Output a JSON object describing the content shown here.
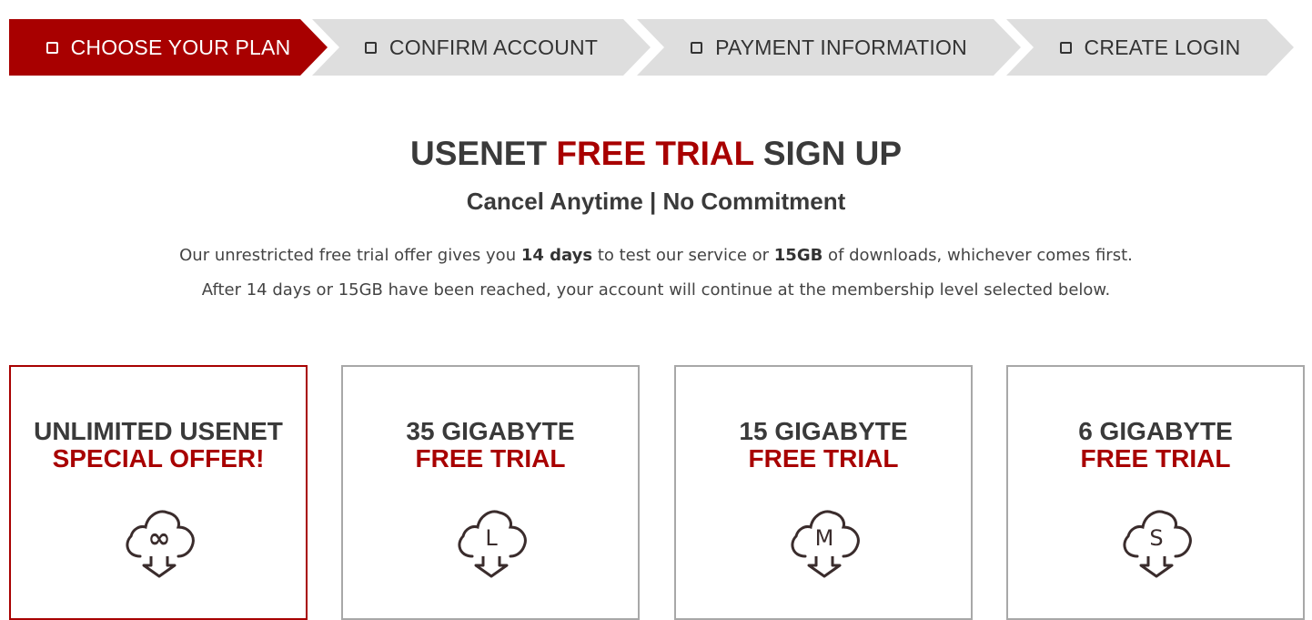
{
  "steps": [
    {
      "label": "CHOOSE YOUR PLAN",
      "active": true
    },
    {
      "label": "CONFIRM ACCOUNT",
      "active": false
    },
    {
      "label": "PAYMENT INFORMATION",
      "active": false
    },
    {
      "label": "CREATE LOGIN",
      "active": false
    }
  ],
  "header": {
    "title_part1": "USENET ",
    "title_highlight": "FREE TRIAL",
    "title_part2": " SIGN UP",
    "subtitle": "Cancel Anytime | No Commitment"
  },
  "description": {
    "line1_a": "Our unrestricted free trial offer gives you ",
    "line1_b": "14 days",
    "line1_c": " to test our service or ",
    "line1_d": "15GB",
    "line1_e": " of downloads, whichever comes first.",
    "line2": "After 14 days or 15GB have been reached, your account will continue at the membership level selected below."
  },
  "plans": [
    {
      "title": "UNLIMITED USENET",
      "subtitle": "SPECIAL OFFER!",
      "icon_label": "∞",
      "icon": "cloud-download-unlimited-icon",
      "selected": true
    },
    {
      "title": "35 GIGABYTE",
      "subtitle": "FREE TRIAL",
      "icon_label": "L",
      "icon": "cloud-download-l-icon",
      "selected": false
    },
    {
      "title": "15 GIGABYTE",
      "subtitle": "FREE TRIAL",
      "icon_label": "M",
      "icon": "cloud-download-m-icon",
      "selected": false
    },
    {
      "title": "6 GIGABYTE",
      "subtitle": "FREE TRIAL",
      "icon_label": "S",
      "icon": "cloud-download-s-icon",
      "selected": false
    }
  ],
  "colors": {
    "accent": "#a80000",
    "text": "#3a3a3a",
    "step_inactive": "#dedede",
    "card_border": "#a8a8a8"
  }
}
